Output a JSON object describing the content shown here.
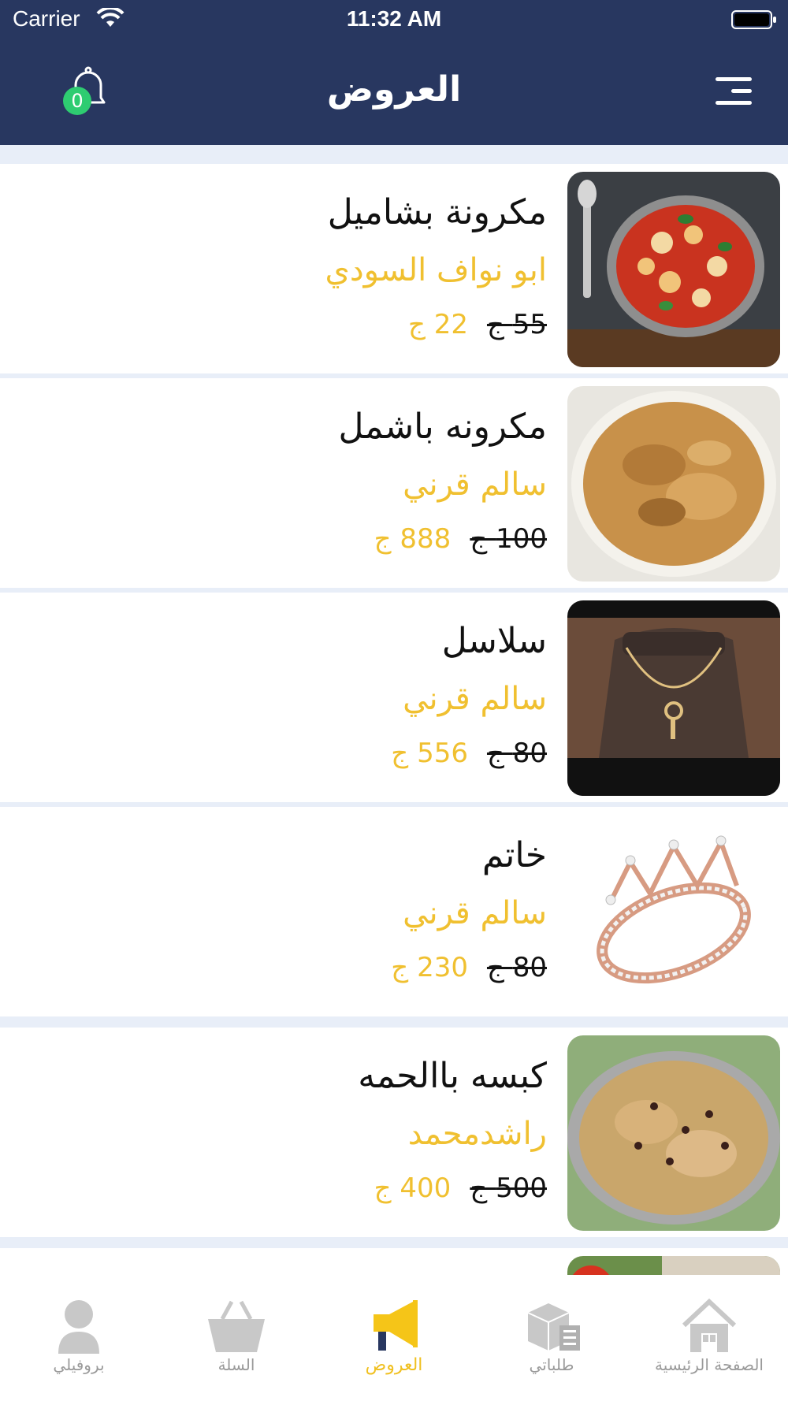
{
  "status_bar": {
    "carrier": "Carrier",
    "time": "11:32 AM"
  },
  "header": {
    "title": "العروض",
    "notification_count": "0"
  },
  "offers": [
    {
      "name": "مكرونة بشاميل",
      "seller": "ابو نواف السودي",
      "old_price": "55 ج",
      "new_price": "22 ج",
      "image": "pasta-casserole"
    },
    {
      "name": "مكرونه باشمل",
      "seller": "سالم قرني",
      "old_price": "100 ج",
      "new_price": "888 ج",
      "image": "baked-pasta"
    },
    {
      "name": "سلاسل",
      "seller": "سالم قرني",
      "old_price": "80 ج",
      "new_price": "556 ج",
      "image": "necklace"
    },
    {
      "name": "خاتم",
      "seller": "سالم قرني",
      "old_price": "80 ج",
      "new_price": "230 ج",
      "image": "crown-ring"
    },
    {
      "name": "كبسه باالحمه",
      "seller": "راشدمحمد",
      "old_price": "500 ج",
      "new_price": "400 ج",
      "image": "kabsa"
    }
  ],
  "tabbar": {
    "profile": "بروفيلي",
    "cart": "السلة",
    "offers": "العروض",
    "orders": "طلباتي",
    "home": "الصفحة الرئيسية"
  },
  "colors": {
    "header_bg": "#283760",
    "accent": "#f0c030",
    "badge": "#2ecc71"
  }
}
